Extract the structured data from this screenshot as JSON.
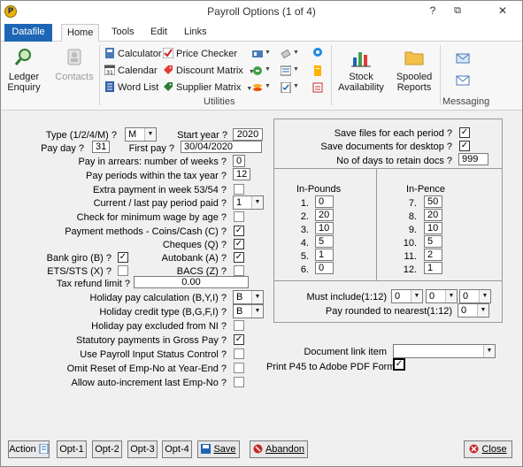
{
  "window": {
    "title": "Payroll Options (1 of 4)",
    "help": "?",
    "restore": "⧉",
    "close": "✕",
    "app_icon": "P"
  },
  "ribbon_tabs": [
    "Datafile",
    "Home",
    "Tools",
    "Edit",
    "Links"
  ],
  "ribbon": {
    "ledger_enquiry": [
      "Ledger",
      "Enquiry"
    ],
    "contacts": "Contacts",
    "calculator": "Calculator",
    "calendar": "Calendar",
    "word_list": "Word List",
    "price_checker": "Price Checker",
    "discount_matrix": "Discount Matrix",
    "supplier_matrix": "Supplier Matrix",
    "stock_availability": [
      "Stock",
      "Availability"
    ],
    "spooled_reports": [
      "Spooled",
      "Reports"
    ],
    "utilities_label": "Utilities",
    "messaging_label": "Messaging",
    "calendar_day": "31"
  },
  "form": {
    "type_label": "Type (1/2/4/M) ?",
    "type_value": "M",
    "start_year_label": "Start year ?",
    "start_year_value": "2020",
    "pay_day_label": "Pay day ?",
    "pay_day_value": "31",
    "first_pay_label": "First pay ?",
    "first_pay_value": "30/04/2020",
    "arrears_label": "Pay in arrears: number of weeks ?",
    "arrears_value": "0",
    "periods_label": "Pay periods within the tax year ?",
    "periods_value": "12",
    "extra_label": "Extra payment in week 53/54 ?",
    "current_last_label": "Current / last pay period paid ?",
    "current_last_value": "1",
    "min_wage_label": "Check for minimum wage by age ?",
    "payment_methods_label": "Payment methods - Coins/Cash (C) ?",
    "cheques_label": "Cheques (Q) ?",
    "bank_giro_label": "Bank giro (B) ?",
    "autobank_label": "Autobank (A) ?",
    "ets_label": "ETS/STS (X) ?",
    "bacs_label": "BACS (Z) ?",
    "tax_refund_label": "Tax refund limit ?",
    "tax_refund_value": "0.00",
    "hol_calc_label": "Holiday pay calculation (B,Y,I) ?",
    "hol_calc_value": "B",
    "hol_credit_label": "Holiday credit type (B,G,F,I) ?",
    "hol_credit_value": "B",
    "hol_excl_label": "Holiday pay excluded from NI ?",
    "stat_label": "Statutory payments in Gross Pay ?",
    "input_status_label": "Use Payroll Input Status Control ?",
    "omit_reset_label": "Omit Reset of Emp-No at Year-End ?",
    "allow_auto_label": "Allow auto-increment last Emp-No ?",
    "save_files_label": "Save files for each period ?",
    "save_docs_label": "Save documents for desktop ?",
    "retain_label": "No of days to retain docs ?",
    "retain_value": "999",
    "in_pounds_label": "In-Pounds",
    "in_pence_label": "In-Pence",
    "pounds": [
      {
        "n": "1.",
        "v": "0"
      },
      {
        "n": "2.",
        "v": "20"
      },
      {
        "n": "3.",
        "v": "10"
      },
      {
        "n": "4.",
        "v": "5"
      },
      {
        "n": "5.",
        "v": "1"
      },
      {
        "n": "6.",
        "v": "0"
      }
    ],
    "pence": [
      {
        "n": "7.",
        "v": "50"
      },
      {
        "n": "8.",
        "v": "20"
      },
      {
        "n": "9.",
        "v": "10"
      },
      {
        "n": "10.",
        "v": "5"
      },
      {
        "n": "11.",
        "v": "2"
      },
      {
        "n": "12.",
        "v": "1"
      }
    ],
    "must_include_label": "Must include(1:12)",
    "must_include_values": [
      "0",
      "0",
      "0"
    ],
    "rounded_label": "Pay rounded to nearest(1:12)",
    "rounded_value": "0",
    "doc_link_label": "Document link item",
    "doc_link_value": "",
    "print_p45_label": "Print P45 to Adobe PDF Form",
    "check_mark": "✓"
  },
  "buttons": {
    "action": "Action",
    "opt1": "Opt-1",
    "opt2": "Opt-2",
    "opt3": "Opt-3",
    "opt4": "Opt-4",
    "save": "Save",
    "abandon": "Abandon",
    "close": "Close"
  },
  "colors": {
    "file_tab": "#1e66b5",
    "checked": "#000000"
  }
}
